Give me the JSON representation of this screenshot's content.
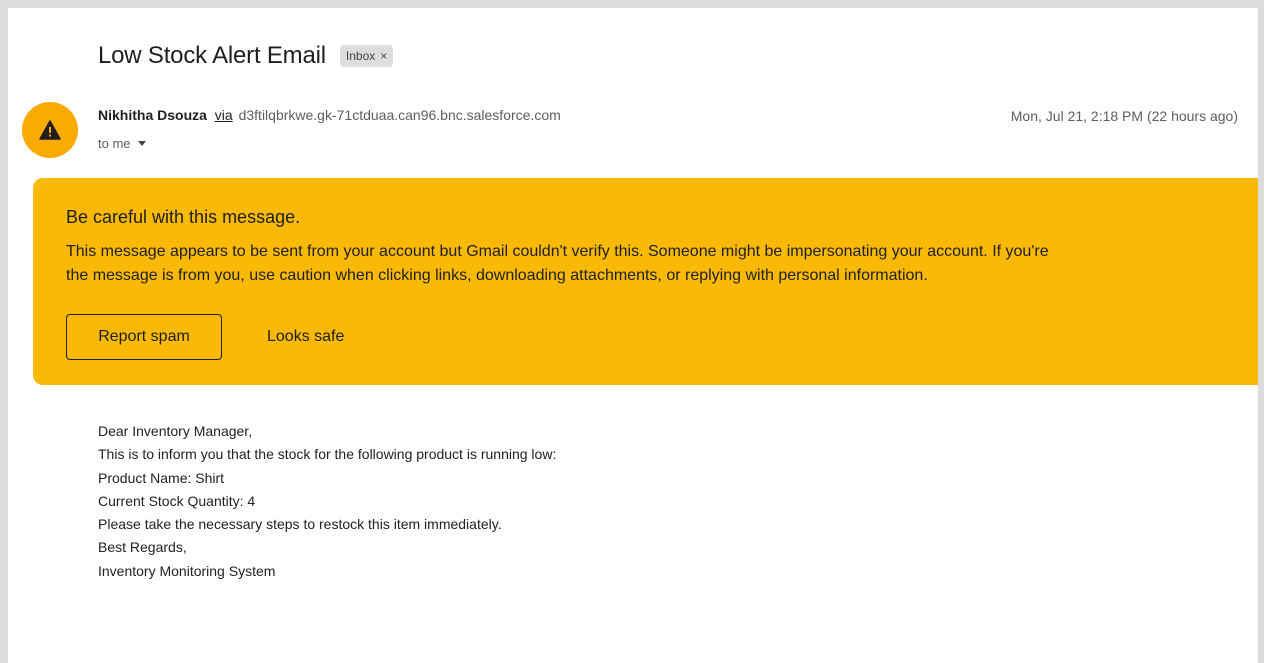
{
  "email": {
    "subject": "Low Stock Alert Email",
    "label": "Inbox",
    "label_remove": "×",
    "sender_name": "Nikhitha Dsouza",
    "via_text": "via",
    "sender_domain": "d3ftilqbrkwe.gk-71ctduaa.can96.bnc.salesforce.com",
    "recipient_text": "to me",
    "date_text": "Mon, Jul 21, 2:18 PM (22 hours ago)"
  },
  "warning": {
    "title": "Be careful with this message.",
    "line1": "This message appears to be sent from your account but Gmail couldn't verify this. Someone might be impersonating your account. If you're",
    "line2": "the message is from you, use caution when clicking links, downloading attachments, or replying with personal information.",
    "report_spam_label": "Report spam",
    "looks_safe_label": "Looks safe"
  },
  "body": {
    "lines": [
      "Dear Inventory Manager,",
      "This is to inform you that the stock for the following product is running low:",
      "Product Name: Shirt",
      "Current Stock Quantity: 4",
      "Please take the necessary steps to restock this item immediately.",
      "Best Regards,",
      "Inventory Monitoring System"
    ]
  },
  "colors": {
    "warning_background": "#f9b904",
    "avatar_background": "#f9ab00"
  },
  "icons": {
    "avatar": "warning-triangle-icon",
    "recipient_dropdown": "caret-down-icon"
  }
}
